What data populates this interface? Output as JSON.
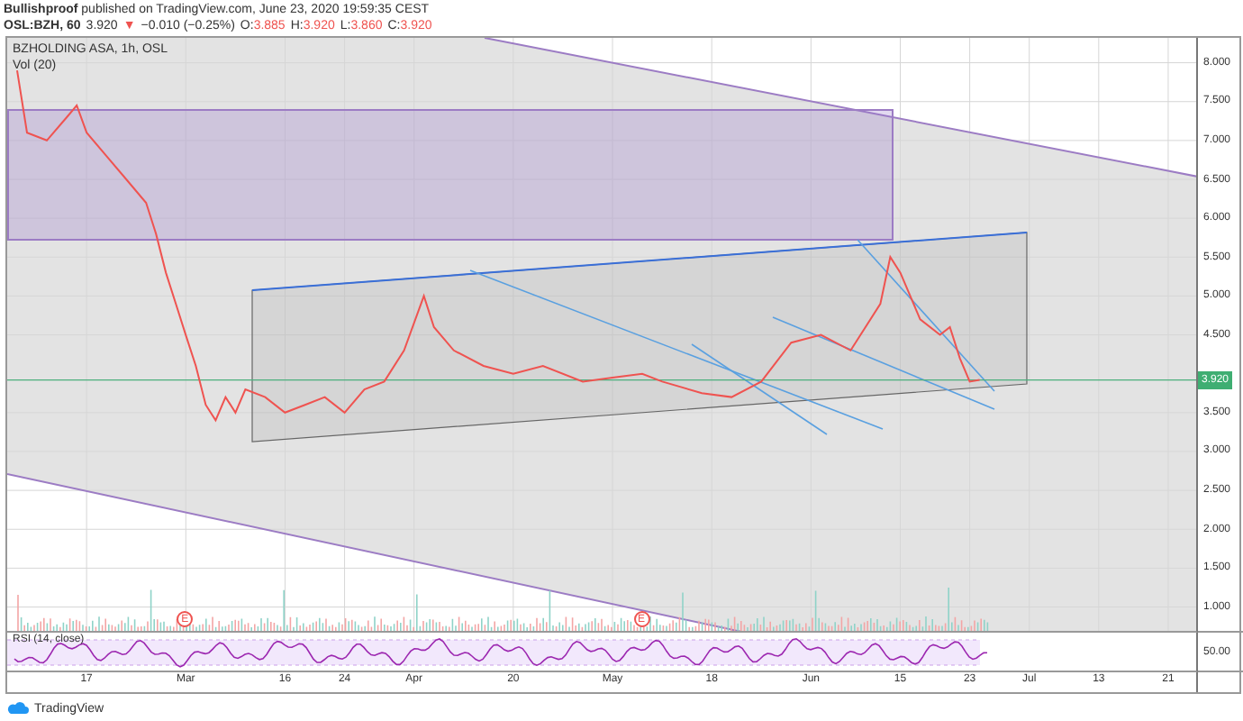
{
  "header": {
    "author": "Bullishproof",
    "published": "published on TradingView.com, June 23, 2020 19:59:35 CEST"
  },
  "quote": {
    "symbol": "OSL:BZH, 60",
    "last": "3.920",
    "arrow": "▼",
    "change": "−0.010 (−0.25%)",
    "ohlc": [
      {
        "label": "O:",
        "value": "3.885"
      },
      {
        "label": "H:",
        "value": "3.920"
      },
      {
        "label": "L:",
        "value": "3.860"
      },
      {
        "label": "C:",
        "value": "3.920"
      }
    ]
  },
  "chart": {
    "title": "BZHOLDING ASA, 1h, OSL",
    "volume_label": "Vol (20)",
    "last_price_label": "3.920",
    "earnings_markers": [
      "E",
      "E"
    ],
    "price_axis": [
      "8.000",
      "7.500",
      "7.000",
      "6.500",
      "6.000",
      "5.500",
      "5.000",
      "4.500",
      "3.500",
      "3.000",
      "2.500",
      "2.000",
      "1.500",
      "1.000"
    ],
    "date_axis": [
      "17",
      "Mar",
      "16",
      "24",
      "Apr",
      "20",
      "May",
      "18",
      "Jun",
      "15",
      "23",
      "Jul",
      "13",
      "21"
    ]
  },
  "rsi": {
    "label": "RSI (14, close)",
    "level_label": "50.00"
  },
  "footer": {
    "brand": "TradingView"
  }
}
